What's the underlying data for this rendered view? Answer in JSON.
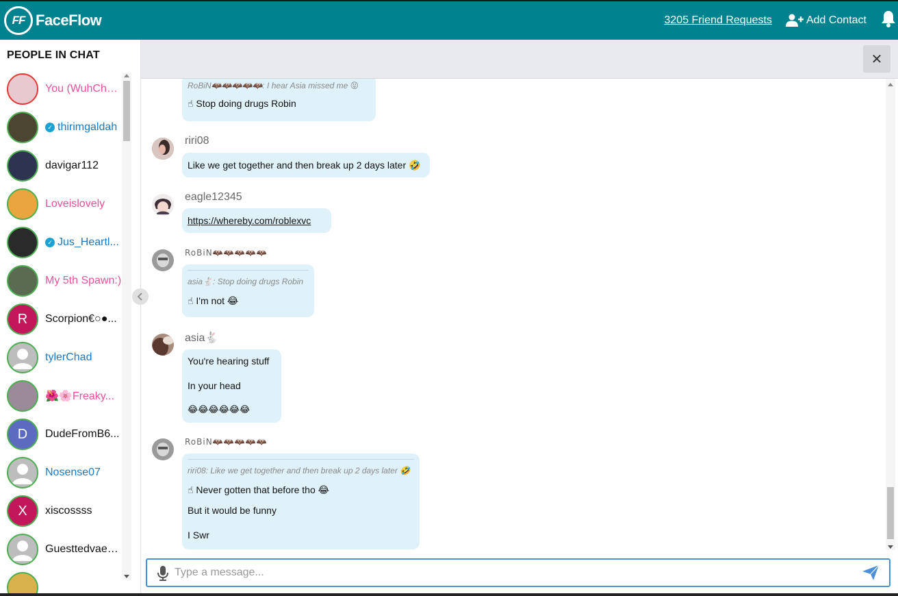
{
  "header": {
    "logo_mark": "FF",
    "app_name": "FaceFlow",
    "friend_requests": "3205 Friend Requests",
    "add_contact": "Add Contact",
    "bg_color": "#00838f"
  },
  "sidebar": {
    "title": "PEOPLE IN CHAT",
    "people": [
      {
        "name": "You (WuhChu...",
        "color": "#ec4f9b",
        "verified": false,
        "initial": "",
        "avatar_bg": "#e8c9cf"
      },
      {
        "name": "thirimgaldah",
        "color": "#1a78c2",
        "verified": true,
        "initial": "",
        "avatar_bg": "#4b4532"
      },
      {
        "name": "davigar112",
        "color": "#111111",
        "verified": false,
        "initial": "",
        "avatar_bg": "#2d3350"
      },
      {
        "name": "Loveislovely",
        "color": "#ec4f9b",
        "verified": false,
        "initial": "",
        "avatar_bg": "#e9a53e"
      },
      {
        "name": "Jus_Heartl...",
        "color": "#1a78c2",
        "verified": true,
        "initial": "",
        "avatar_bg": "#2a2a2a"
      },
      {
        "name": "My 5th Spawn:)",
        "color": "#ec4f9b",
        "verified": false,
        "initial": "",
        "avatar_bg": "#5a6b52"
      },
      {
        "name": "Scorpion€○●...",
        "color": "#111111",
        "verified": false,
        "initial": "R",
        "avatar_bg": "#c2185b"
      },
      {
        "name": "tylerChad",
        "color": "#1a78c2",
        "verified": false,
        "initial": "",
        "avatar_bg": "#bdbdbd"
      },
      {
        "name": "🌺🌸Freaky...",
        "color": "#ec4f9b",
        "verified": false,
        "initial": "",
        "avatar_bg": "#9a8a9a"
      },
      {
        "name": "DudeFromB6...",
        "color": "#111111",
        "verified": false,
        "initial": "D",
        "avatar_bg": "#5c6bc0"
      },
      {
        "name": "Nosense07",
        "color": "#1a78c2",
        "verified": false,
        "initial": "",
        "avatar_bg": "#bdbdbd"
      },
      {
        "name": "xiscossss",
        "color": "#111111",
        "verified": false,
        "initial": "X",
        "avatar_bg": "#c2185b"
      },
      {
        "name": "Guesttedvaeb...",
        "color": "#111111",
        "verified": false,
        "initial": "",
        "avatar_bg": "#bdbdbd"
      },
      {
        "name": "",
        "color": "#111111",
        "verified": false,
        "initial": "",
        "avatar_bg": "#d8b14a"
      }
    ]
  },
  "chat": {
    "messages": [
      {
        "user": "",
        "avatar_bg": "",
        "reply": "RoBiN🦇🦇🦇🦇🦇: I hear Asia missed me 😝",
        "lines": [
          "☝ Stop doing drugs Robin"
        ]
      },
      {
        "user": "riri08",
        "avatar_bg": "#7a5a55",
        "reply": "",
        "lines": [
          "Like we get together and then break up 2 days later 🤣"
        ]
      },
      {
        "user": "eagle12345",
        "avatar_bg": "#4a3e4e",
        "reply": "",
        "lines": [
          "https://whereby.com/roblexvc"
        ]
      },
      {
        "user": "RoBiN🦇🦇🦇🦇🦇",
        "avatar_bg": "#8f8f8f",
        "reply": "asia🐇: Stop doing drugs Robin",
        "lines": [
          "☝ I'm not 😂"
        ]
      },
      {
        "user": "asia🐇",
        "avatar_bg": "#6b4a3e",
        "reply": "",
        "lines": [
          "You're hearing stuff",
          "In your head",
          "😂😂😂😂😂😂"
        ]
      },
      {
        "user": "RoBiN🦇🦇🦇🦇🦇",
        "avatar_bg": "#8f8f8f",
        "reply": "riri08: Like we get together and then break up 2 days later 🤣",
        "lines": [
          "☝ Never gotten that before tho 😂",
          "But it would be funny",
          "I Swr"
        ]
      }
    ]
  },
  "composer": {
    "placeholder": "Type a message..."
  }
}
